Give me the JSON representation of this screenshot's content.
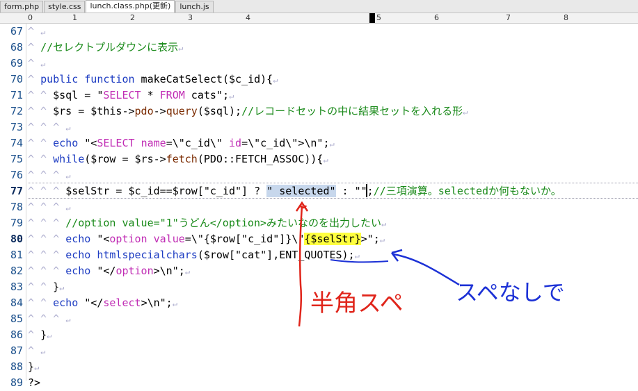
{
  "tabs": [
    {
      "label": "form.php"
    },
    {
      "label": "style.css"
    },
    {
      "label": "lunch.class.php(更新)"
    },
    {
      "label": "lunch.js"
    }
  ],
  "ruler": {
    "labels": [
      "0",
      "1",
      "2",
      "3",
      "4",
      "5",
      "6",
      "7",
      "8"
    ]
  },
  "line_numbers": [
    "67",
    "68",
    "69",
    "70",
    "71",
    "72",
    "73",
    "74",
    "75",
    "76",
    "77",
    "78",
    "79",
    "80",
    "81",
    "82",
    "83",
    "84",
    "85",
    "86",
    "87",
    "88",
    "89"
  ],
  "annotations": {
    "left_note": "半角スペ",
    "right_note": "スペなしで"
  },
  "colors": {
    "annotation": "#e0251b",
    "annotation2": "#1c31d6",
    "keyword": "#1d3cc2",
    "string_keyword": "#c02cb4",
    "comment": "#1a8a1a"
  }
}
